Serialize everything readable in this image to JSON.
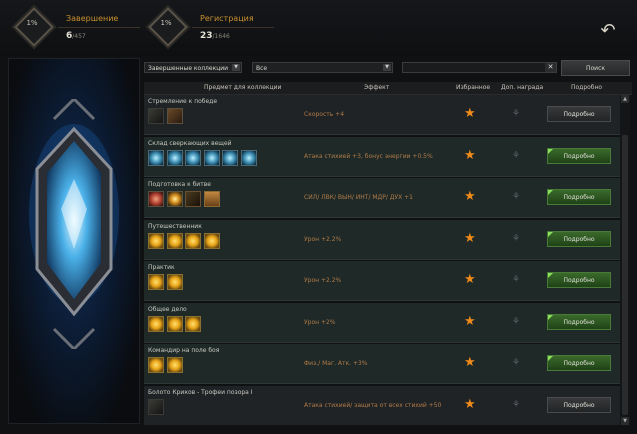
{
  "stats": [
    {
      "pct": "1%",
      "label": "Завершение",
      "count": "6",
      "total": "/457"
    },
    {
      "pct": "1%",
      "label": "Регистрация",
      "count": "23",
      "total": "/1646"
    }
  ],
  "filters": {
    "status": "Завершенные коллекции",
    "category": "Все",
    "search": "",
    "search_btn": "Поиск"
  },
  "headers": {
    "item": "Предмет для коллекции",
    "effect": "Эффект",
    "fav": "Избранное",
    "bonus": "Доп. награда",
    "details": "Подробно"
  },
  "rows": [
    {
      "name": "Стремление к победе",
      "effect": "Скорость +4",
      "btn": "Подробно",
      "btn_state": "normal",
      "icons": [
        "dark",
        "brown"
      ]
    },
    {
      "name": "Склад сверкающих вещей",
      "effect": "Атака стихией +3, бонус энергии +0.5%",
      "btn": "Подробно",
      "btn_state": "green",
      "icons": [
        "blue",
        "blue",
        "blue",
        "blue",
        "blue",
        "blue"
      ]
    },
    {
      "name": "Подготовка к битве",
      "effect": "СИЛ/ ЛВК/ ВЫН/ ИНТ/ МДР/ ДУХ +1",
      "btn": "Подробно",
      "btn_state": "green",
      "icons": [
        "red",
        "sun",
        "book",
        "chest"
      ]
    },
    {
      "name": "Путешественник",
      "effect": "Урон +2.2%",
      "btn": "Подробно",
      "btn_state": "green",
      "icons": [
        "gold",
        "gold",
        "gold",
        "gold"
      ]
    },
    {
      "name": "Практик",
      "effect": "Урон +2.2%",
      "btn": "Подробно",
      "btn_state": "green",
      "icons": [
        "gold",
        "gold"
      ]
    },
    {
      "name": "Общее дело",
      "effect": "Урон +2%",
      "btn": "Подробно",
      "btn_state": "green",
      "icons": [
        "gold",
        "gold",
        "gold"
      ]
    },
    {
      "name": "Командир на поле боя",
      "effect": "Физ./ Маг. Атк. +3%",
      "btn": "Подробно",
      "btn_state": "green",
      "icons": [
        "gold",
        "gold"
      ]
    },
    {
      "name": "Болото Криков - Трофеи позора I",
      "effect": "Атака стихией/ защита от всех стихий +50",
      "btn": "Подробно",
      "btn_state": "normal",
      "icons": [
        "dark"
      ]
    }
  ],
  "colors": {
    "accent": "#c8902e",
    "star": "#f08a1a",
    "green_btn": "#3a6a2a",
    "effect_text": "#b07a48"
  }
}
